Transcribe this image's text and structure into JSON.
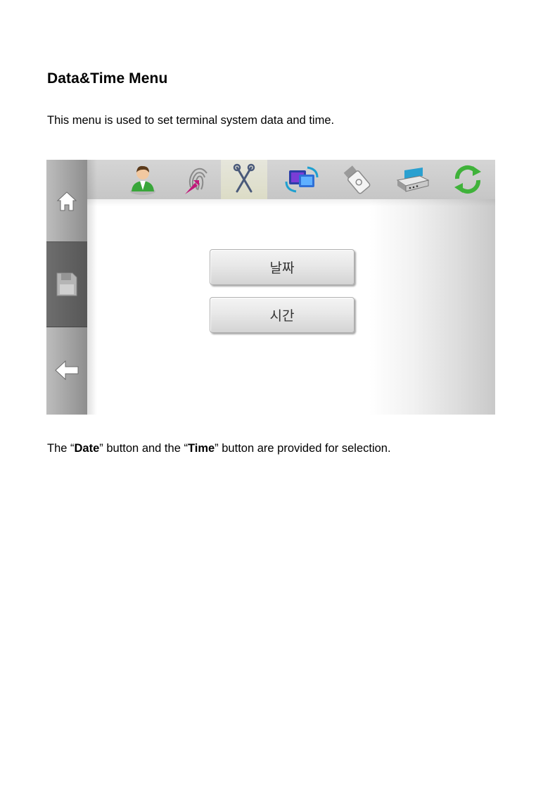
{
  "doc": {
    "heading": "Data&Time Menu",
    "intro": "This menu is used to set terminal system data and time.",
    "caption": {
      "part1": "The “",
      "date_word": "Date",
      "part2": "” button and the “",
      "time_word": "Time",
      "part3": "” button are provided for selection."
    }
  },
  "device": {
    "sidebar": [
      "home-icon",
      "save-icon",
      "back-arrow-icon"
    ],
    "tabs": [
      "user-icon",
      "fingerprint-icon",
      "tools-icon",
      "network-icon",
      "usb-icon",
      "printer-icon",
      "refresh-icon"
    ],
    "active_tab": "tools-icon",
    "buttons": {
      "date": "날짜",
      "time": "시간"
    }
  }
}
